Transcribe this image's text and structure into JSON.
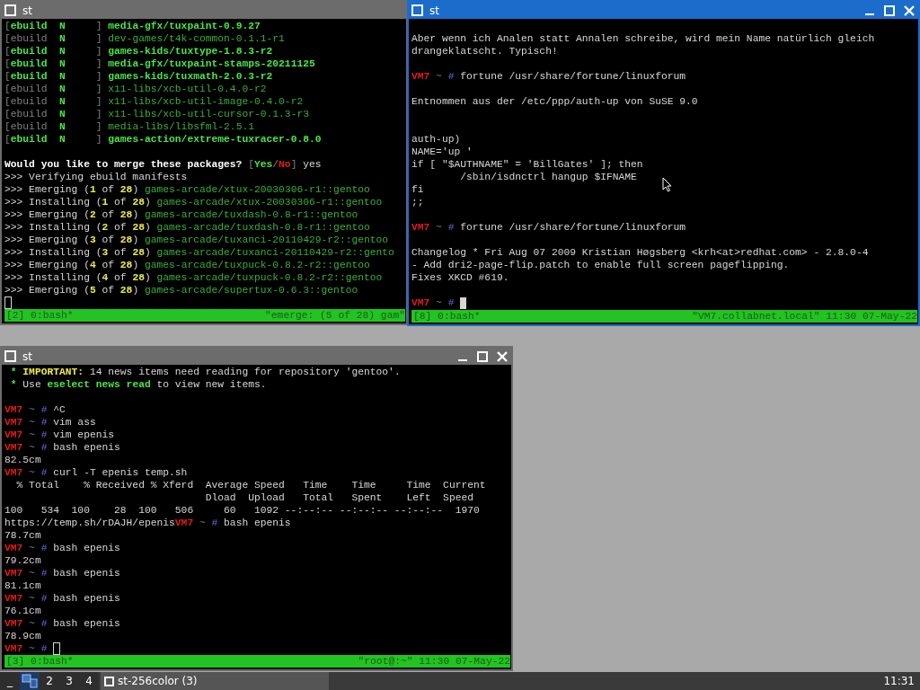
{
  "windows": [
    {
      "title": "st",
      "active": false,
      "lines": [
        {
          "kind": "text",
          "segments": [
            {
              "t": "[",
              "kind": "gray"
            },
            {
              "t": "ebuild  N",
              "kind": "greenbold"
            },
            {
              "t": "     ] ",
              "kind": "gray"
            },
            {
              "t": "media-gfx/tuxpaint-0.9.27",
              "kind": "greenbold"
            }
          ]
        },
        {
          "kind": "text",
          "segments": [
            {
              "t": "[ebuild  ",
              "kind": "gray"
            },
            {
              "t": "N",
              "kind": "greenbold"
            },
            {
              "t": "     ] ",
              "kind": "gray"
            },
            {
              "t": "dev-games/t4k-common-0.1.1-r1",
              "kind": "green"
            }
          ]
        },
        {
          "kind": "text",
          "segments": [
            {
              "t": "[",
              "kind": "gray"
            },
            {
              "t": "ebuild  N",
              "kind": "greenbold"
            },
            {
              "t": "     ] ",
              "kind": "gray"
            },
            {
              "t": "games-kids/tuxtype-1.8.3-r2",
              "kind": "greenbold"
            }
          ]
        },
        {
          "kind": "text",
          "segments": [
            {
              "t": "[",
              "kind": "gray"
            },
            {
              "t": "ebuild  N",
              "kind": "greenbold"
            },
            {
              "t": "     ] ",
              "kind": "gray"
            },
            {
              "t": "media-gfx/tuxpaint-stamps-20211125",
              "kind": "greenbold"
            }
          ]
        },
        {
          "kind": "text",
          "segments": [
            {
              "t": "[",
              "kind": "gray"
            },
            {
              "t": "ebuild  N",
              "kind": "greenbold"
            },
            {
              "t": "     ] ",
              "kind": "gray"
            },
            {
              "t": "games-kids/tuxmath-2.0.3-r2",
              "kind": "greenbold"
            }
          ]
        },
        {
          "kind": "text",
          "segments": [
            {
              "t": "[ebuild  ",
              "kind": "gray"
            },
            {
              "t": "N",
              "kind": "greenbold"
            },
            {
              "t": "     ] ",
              "kind": "gray"
            },
            {
              "t": "x11-libs/xcb-util-0.4.0-r2",
              "kind": "green"
            }
          ]
        },
        {
          "kind": "text",
          "segments": [
            {
              "t": "[ebuild  ",
              "kind": "gray"
            },
            {
              "t": "N",
              "kind": "greenbold"
            },
            {
              "t": "     ] ",
              "kind": "gray"
            },
            {
              "t": "x11-libs/xcb-util-image-0.4.0-r2",
              "kind": "green"
            }
          ]
        },
        {
          "kind": "text",
          "segments": [
            {
              "t": "[ebuild  ",
              "kind": "gray"
            },
            {
              "t": "N",
              "kind": "greenbold"
            },
            {
              "t": "     ] ",
              "kind": "gray"
            },
            {
              "t": "x11-libs/xcb-util-cursor-0.1.3-r3",
              "kind": "green"
            }
          ]
        },
        {
          "kind": "text",
          "segments": [
            {
              "t": "[ebuild  ",
              "kind": "gray"
            },
            {
              "t": "N",
              "kind": "greenbold"
            },
            {
              "t": "     ] ",
              "kind": "gray"
            },
            {
              "t": "media-libs/libsfml-2.5.1",
              "kind": "green"
            }
          ]
        },
        {
          "kind": "text",
          "segments": [
            {
              "t": "[",
              "kind": "gray"
            },
            {
              "t": "ebuild  N",
              "kind": "greenbold"
            },
            {
              "t": "     ] ",
              "kind": "gray"
            },
            {
              "t": "games-action/extreme-tuxracer-0.8.0",
              "kind": "greenbold"
            }
          ]
        },
        {
          "kind": "blank"
        },
        {
          "kind": "text",
          "segments": [
            {
              "t": "Would you like to merge these packages? ",
              "kind": "bold"
            },
            {
              "t": "[",
              "kind": "gray"
            },
            {
              "t": "Yes",
              "kind": "greenbold"
            },
            {
              "t": "/",
              "kind": "gray"
            },
            {
              "t": "No",
              "kind": "redbold"
            },
            {
              "t": "] ",
              "kind": "gray"
            },
            {
              "t": "yes",
              "kind": "plain"
            }
          ]
        },
        {
          "kind": "text",
          "segments": [
            {
              "t": ">>> Verifying ebuild manifests",
              "kind": "plain"
            }
          ]
        },
        {
          "kind": "text",
          "segments": [
            {
              "t": ">>> Emerging (",
              "kind": "plain"
            },
            {
              "t": "1",
              "kind": "yellowbold"
            },
            {
              "t": " of ",
              "kind": "plain"
            },
            {
              "t": "28",
              "kind": "yellowbold"
            },
            {
              "t": ") ",
              "kind": "plain"
            },
            {
              "t": "games-arcade/xtux-20030306-r1::gentoo",
              "kind": "green"
            }
          ]
        },
        {
          "kind": "text",
          "segments": [
            {
              "t": ">>> Installing (",
              "kind": "plain"
            },
            {
              "t": "1",
              "kind": "yellowbold"
            },
            {
              "t": " of ",
              "kind": "plain"
            },
            {
              "t": "28",
              "kind": "yellowbold"
            },
            {
              "t": ") ",
              "kind": "plain"
            },
            {
              "t": "games-arcade/xtux-20030306-r1::gentoo",
              "kind": "green"
            }
          ]
        },
        {
          "kind": "text",
          "segments": [
            {
              "t": ">>> Emerging (",
              "kind": "plain"
            },
            {
              "t": "2",
              "kind": "yellowbold"
            },
            {
              "t": " of ",
              "kind": "plain"
            },
            {
              "t": "28",
              "kind": "yellowbold"
            },
            {
              "t": ") ",
              "kind": "plain"
            },
            {
              "t": "games-arcade/tuxdash-0.8-r1::gentoo",
              "kind": "green"
            }
          ]
        },
        {
          "kind": "text",
          "segments": [
            {
              "t": ">>> Installing (",
              "kind": "plain"
            },
            {
              "t": "2",
              "kind": "yellowbold"
            },
            {
              "t": " of ",
              "kind": "plain"
            },
            {
              "t": "28",
              "kind": "yellowbold"
            },
            {
              "t": ") ",
              "kind": "plain"
            },
            {
              "t": "games-arcade/tuxdash-0.8-r1::gentoo",
              "kind": "green"
            }
          ]
        },
        {
          "kind": "text",
          "segments": [
            {
              "t": ">>> Emerging (",
              "kind": "plain"
            },
            {
              "t": "3",
              "kind": "yellowbold"
            },
            {
              "t": " of ",
              "kind": "plain"
            },
            {
              "t": "28",
              "kind": "yellowbold"
            },
            {
              "t": ") ",
              "kind": "plain"
            },
            {
              "t": "games-arcade/tuxanci-20110429-r2::gentoo",
              "kind": "green"
            }
          ]
        },
        {
          "kind": "text",
          "segments": [
            {
              "t": ">>> Installing (",
              "kind": "plain"
            },
            {
              "t": "3",
              "kind": "yellowbold"
            },
            {
              "t": " of ",
              "kind": "plain"
            },
            {
              "t": "28",
              "kind": "yellowbold"
            },
            {
              "t": ") ",
              "kind": "plain"
            },
            {
              "t": "games-arcade/tuxanci-20110429-r2::gento",
              "kind": "green"
            }
          ]
        },
        {
          "kind": "text",
          "segments": [
            {
              "t": ">>> Emerging (",
              "kind": "plain"
            },
            {
              "t": "4",
              "kind": "yellowbold"
            },
            {
              "t": " of ",
              "kind": "plain"
            },
            {
              "t": "28",
              "kind": "yellowbold"
            },
            {
              "t": ") ",
              "kind": "plain"
            },
            {
              "t": "games-arcade/tuxpuck-0.8.2-r2::gentoo",
              "kind": "green"
            }
          ]
        },
        {
          "kind": "text",
          "segments": [
            {
              "t": ">>> Installing (",
              "kind": "plain"
            },
            {
              "t": "4",
              "kind": "yellowbold"
            },
            {
              "t": " of ",
              "kind": "plain"
            },
            {
              "t": "28",
              "kind": "yellowbold"
            },
            {
              "t": ") ",
              "kind": "plain"
            },
            {
              "t": "games-arcade/tuxpuck-0.8.2-r2::gentoo",
              "kind": "green"
            }
          ]
        },
        {
          "kind": "text",
          "segments": [
            {
              "t": ">>> Emerging (",
              "kind": "plain"
            },
            {
              "t": "5",
              "kind": "yellowbold"
            },
            {
              "t": " of ",
              "kind": "plain"
            },
            {
              "t": "28",
              "kind": "yellowbold"
            },
            {
              "t": ") ",
              "kind": "plain"
            },
            {
              "t": "games-arcade/supertux-0.6.3::gentoo",
              "kind": "green"
            }
          ]
        },
        {
          "kind": "hollow"
        }
      ],
      "status": {
        "left": "[2] 0:bash*",
        "right": "\"emerge: (5 of 28) gam\""
      }
    },
    {
      "title": "st",
      "active": true,
      "controls": [
        {
          "kind": "minimize"
        },
        {
          "kind": "maximize"
        },
        {
          "kind": "close"
        }
      ],
      "lines": [
        {
          "kind": "blank"
        },
        {
          "kind": "text",
          "segments": [
            {
              "t": "Aber wenn ich Analen statt Annalen schreibe, wird mein Name natürlich gleich",
              "kind": "plain"
            }
          ]
        },
        {
          "kind": "text",
          "segments": [
            {
              "t": "drangeklatscht. Typisch!",
              "kind": "plain"
            }
          ]
        },
        {
          "kind": "blank"
        },
        {
          "kind": "text",
          "segments": [
            {
              "t": "VM7",
              "kind": "redbold"
            },
            {
              "t": " ~ ",
              "kind": "gray"
            },
            {
              "t": "# ",
              "kind": "blue"
            },
            {
              "t": "fortune /usr/share/fortune/linuxforum",
              "kind": "plain"
            }
          ]
        },
        {
          "kind": "blank"
        },
        {
          "kind": "text",
          "segments": [
            {
              "t": "Entnommen aus der /etc/ppp/auth-up von SuSE 9.0",
              "kind": "plain"
            }
          ]
        },
        {
          "kind": "blank"
        },
        {
          "kind": "blank"
        },
        {
          "kind": "text",
          "segments": [
            {
              "t": "auth-up)",
              "kind": "plain"
            }
          ]
        },
        {
          "kind": "text",
          "segments": [
            {
              "t": "NAME='up '",
              "kind": "plain"
            }
          ]
        },
        {
          "kind": "text",
          "segments": [
            {
              "t": "if [ \"$AUTHNAME\" = 'BillGates' ]; then",
              "kind": "plain"
            }
          ]
        },
        {
          "kind": "text",
          "segments": [
            {
              "t": "        /sbin/isdnctrl hangup $IFNAME",
              "kind": "plain"
            }
          ]
        },
        {
          "kind": "text",
          "segments": [
            {
              "t": "fi",
              "kind": "plain"
            }
          ]
        },
        {
          "kind": "text",
          "segments": [
            {
              "t": ";;",
              "kind": "plain"
            }
          ]
        },
        {
          "kind": "blank"
        },
        {
          "kind": "text",
          "segments": [
            {
              "t": "VM7",
              "kind": "redbold"
            },
            {
              "t": " ~ ",
              "kind": "gray"
            },
            {
              "t": "# ",
              "kind": "blue"
            },
            {
              "t": "fortune /usr/share/fortune/linuxforum",
              "kind": "plain"
            }
          ]
        },
        {
          "kind": "blank"
        },
        {
          "kind": "text",
          "segments": [
            {
              "t": "Changelog * Fri Aug 07 2009 Kristian Høgsberg <krh<at>redhat.com> - 2.8.0-4",
              "kind": "plain"
            }
          ]
        },
        {
          "kind": "text",
          "segments": [
            {
              "t": "- Add dri2-page-flip.patch to enable full screen pageflipping.",
              "kind": "plain"
            }
          ]
        },
        {
          "kind": "text",
          "segments": [
            {
              "t": "Fixes XKCD #619.",
              "kind": "plain"
            }
          ]
        },
        {
          "kind": "blank"
        },
        {
          "kind": "block",
          "segments": [
            {
              "t": "VM7",
              "kind": "redbold"
            },
            {
              "t": " ~ ",
              "kind": "gray"
            },
            {
              "t": "# ",
              "kind": "blue"
            }
          ]
        }
      ],
      "status": {
        "left": "[8] 0:bash*",
        "right": "\"VM7.collabnet.local\" 11:30 07-May-22"
      }
    },
    {
      "title": "st",
      "active": false,
      "controls": [
        {
          "kind": "minimize"
        },
        {
          "kind": "maximize"
        },
        {
          "kind": "close"
        }
      ],
      "lines": [
        {
          "kind": "text",
          "segments": [
            {
              "t": " * ",
              "kind": "greenbold"
            },
            {
              "t": "IMPORTANT:",
              "kind": "yellowbold"
            },
            {
              "t": " 14 news items need reading for repository 'gentoo'.",
              "kind": "plain"
            }
          ]
        },
        {
          "kind": "text",
          "segments": [
            {
              "t": " * ",
              "kind": "greenbold"
            },
            {
              "t": "Use ",
              "kind": "plain"
            },
            {
              "t": "eselect news read",
              "kind": "greenbold"
            },
            {
              "t": " to view new items.",
              "kind": "plain"
            }
          ]
        },
        {
          "kind": "blank"
        },
        {
          "kind": "text",
          "segments": [
            {
              "t": "VM7",
              "kind": "redbold"
            },
            {
              "t": " ~ ",
              "kind": "gray"
            },
            {
              "t": "# ",
              "kind": "blue"
            },
            {
              "t": "^C",
              "kind": "plain"
            }
          ]
        },
        {
          "kind": "text",
          "segments": [
            {
              "t": "VM7",
              "kind": "redbold"
            },
            {
              "t": " ~ ",
              "kind": "gray"
            },
            {
              "t": "# ",
              "kind": "blue"
            },
            {
              "t": "vim ass",
              "kind": "plain"
            }
          ]
        },
        {
          "kind": "text",
          "segments": [
            {
              "t": "VM7",
              "kind": "redbold"
            },
            {
              "t": " ~ ",
              "kind": "gray"
            },
            {
              "t": "# ",
              "kind": "blue"
            },
            {
              "t": "vim epenis",
              "kind": "plain"
            }
          ]
        },
        {
          "kind": "text",
          "segments": [
            {
              "t": "VM7",
              "kind": "redbold"
            },
            {
              "t": " ~ ",
              "kind": "gray"
            },
            {
              "t": "# ",
              "kind": "blue"
            },
            {
              "t": "bash epenis",
              "kind": "plain"
            }
          ]
        },
        {
          "kind": "text",
          "segments": [
            {
              "t": "82.5cm",
              "kind": "plain"
            }
          ]
        },
        {
          "kind": "text",
          "segments": [
            {
              "t": "VM7",
              "kind": "redbold"
            },
            {
              "t": " ~ ",
              "kind": "gray"
            },
            {
              "t": "# ",
              "kind": "blue"
            },
            {
              "t": "curl -T epenis temp.sh",
              "kind": "plain"
            }
          ]
        },
        {
          "kind": "text",
          "segments": [
            {
              "t": "  % Total    % Received % Xferd  Average Speed   Time    Time     Time  Current",
              "kind": "plain"
            }
          ]
        },
        {
          "kind": "text",
          "segments": [
            {
              "t": "                                 Dload  Upload   Total   Spent    Left  Speed",
              "kind": "plain"
            }
          ]
        },
        {
          "kind": "text",
          "segments": [
            {
              "t": "100   534  100    28  100   506     60   1092 --:--:-- --:--:-- --:--:--  1970",
              "kind": "plain"
            }
          ]
        },
        {
          "kind": "text",
          "segments": [
            {
              "t": "https://temp.sh/rDAJH/epenis",
              "kind": "plain"
            },
            {
              "t": "VM7",
              "kind": "redbold"
            },
            {
              "t": " ~ ",
              "kind": "gray"
            },
            {
              "t": "# ",
              "kind": "blue"
            },
            {
              "t": "bash epenis",
              "kind": "plain"
            }
          ]
        },
        {
          "kind": "text",
          "segments": [
            {
              "t": "78.7cm",
              "kind": "plain"
            }
          ]
        },
        {
          "kind": "text",
          "segments": [
            {
              "t": "VM7",
              "kind": "redbold"
            },
            {
              "t": " ~ ",
              "kind": "gray"
            },
            {
              "t": "# ",
              "kind": "blue"
            },
            {
              "t": "bash epenis",
              "kind": "plain"
            }
          ]
        },
        {
          "kind": "text",
          "segments": [
            {
              "t": "79.2cm",
              "kind": "plain"
            }
          ]
        },
        {
          "kind": "text",
          "segments": [
            {
              "t": "VM7",
              "kind": "redbold"
            },
            {
              "t": " ~ ",
              "kind": "gray"
            },
            {
              "t": "# ",
              "kind": "blue"
            },
            {
              "t": "bash epenis",
              "kind": "plain"
            }
          ]
        },
        {
          "kind": "text",
          "segments": [
            {
              "t": "81.1cm",
              "kind": "plain"
            }
          ]
        },
        {
          "kind": "text",
          "segments": [
            {
              "t": "VM7",
              "kind": "redbold"
            },
            {
              "t": " ~ ",
              "kind": "gray"
            },
            {
              "t": "# ",
              "kind": "blue"
            },
            {
              "t": "bash epenis",
              "kind": "plain"
            }
          ]
        },
        {
          "kind": "text",
          "segments": [
            {
              "t": "76.1cm",
              "kind": "plain"
            }
          ]
        },
        {
          "kind": "text",
          "segments": [
            {
              "t": "VM7",
              "kind": "redbold"
            },
            {
              "t": " ~ ",
              "kind": "gray"
            },
            {
              "t": "# ",
              "kind": "blue"
            },
            {
              "t": "bash epenis",
              "kind": "plain"
            }
          ]
        },
        {
          "kind": "text",
          "segments": [
            {
              "t": "78.9cm",
              "kind": "plain"
            }
          ]
        },
        {
          "kind": "hollow",
          "segments": [
            {
              "t": "VM7",
              "kind": "redbold"
            },
            {
              "t": " ~ ",
              "kind": "gray"
            },
            {
              "t": "# ",
              "kind": "blue"
            }
          ]
        }
      ],
      "status": {
        "left": "[3] 0:bash*",
        "right": "\"root@:~\" 11:30 07-May-22"
      }
    }
  ],
  "taskbar": {
    "show_desktop": "_",
    "workspaces": [
      {
        "selected": true
      },
      {
        "label": "2",
        "selected": false
      },
      {
        "label": "3",
        "selected": false
      },
      {
        "label": "4",
        "selected": false
      }
    ],
    "task": {
      "label": "st-256color (3)"
    },
    "clock": "11:31"
  }
}
